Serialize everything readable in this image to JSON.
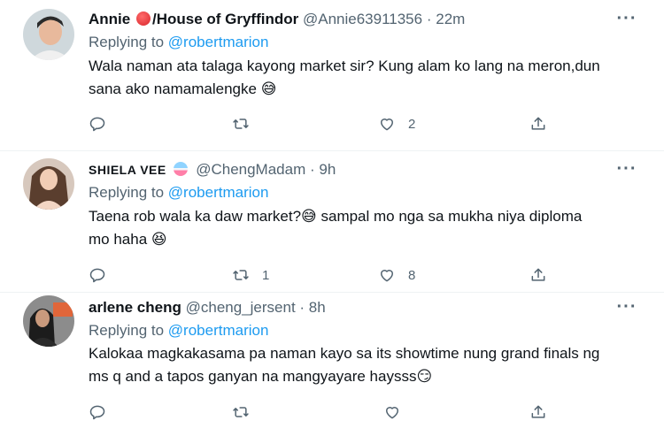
{
  "tweets": [
    {
      "name": "Annie",
      "name_suffix": "/House of Gryffindor",
      "handle": "@Annie63911356",
      "time": "22m",
      "reply_prefix": "Replying to",
      "reply_to": "@robertmarion",
      "text_line1": "Wala naman ata talaga kayong market sir? Kung alam ko lang na meron,dun",
      "text_line2": "sana ako namamalengke",
      "emoji": "😅",
      "reply_count": "",
      "retweet_count": "",
      "like_count": "2"
    },
    {
      "name": "SHIELA VEE",
      "handle": "@ChengMadam",
      "time": "9h",
      "reply_prefix": "Replying to",
      "reply_to": "@robertmarion",
      "text_line1": "Taena rob wala ka daw market?",
      "emoji1": "😅",
      "text_line1b": " sampal mo nga sa mukha niya diploma",
      "text_line2": "mo haha",
      "emoji2": "😆",
      "reply_count": "",
      "retweet_count": "1",
      "like_count": "8"
    },
    {
      "name": "arlene cheng",
      "handle": "@cheng_jersent",
      "time": "8h",
      "reply_prefix": "Replying to",
      "reply_to": "@robertmarion",
      "text_line1": "Kalokaa magkakasama pa naman kayo sa its showtime nung grand finals ng",
      "text_line2": "ms q and a tapos ganyan na mangyayare haysss",
      "emoji": "😏",
      "reply_count": "",
      "retweet_count": "",
      "like_count": ""
    }
  ],
  "colors": {
    "link": "#1d9bf0",
    "muted": "#536471",
    "text": "#0f1419"
  },
  "icons": [
    "reply-icon",
    "retweet-icon",
    "like-icon",
    "share-icon",
    "more-icon"
  ]
}
